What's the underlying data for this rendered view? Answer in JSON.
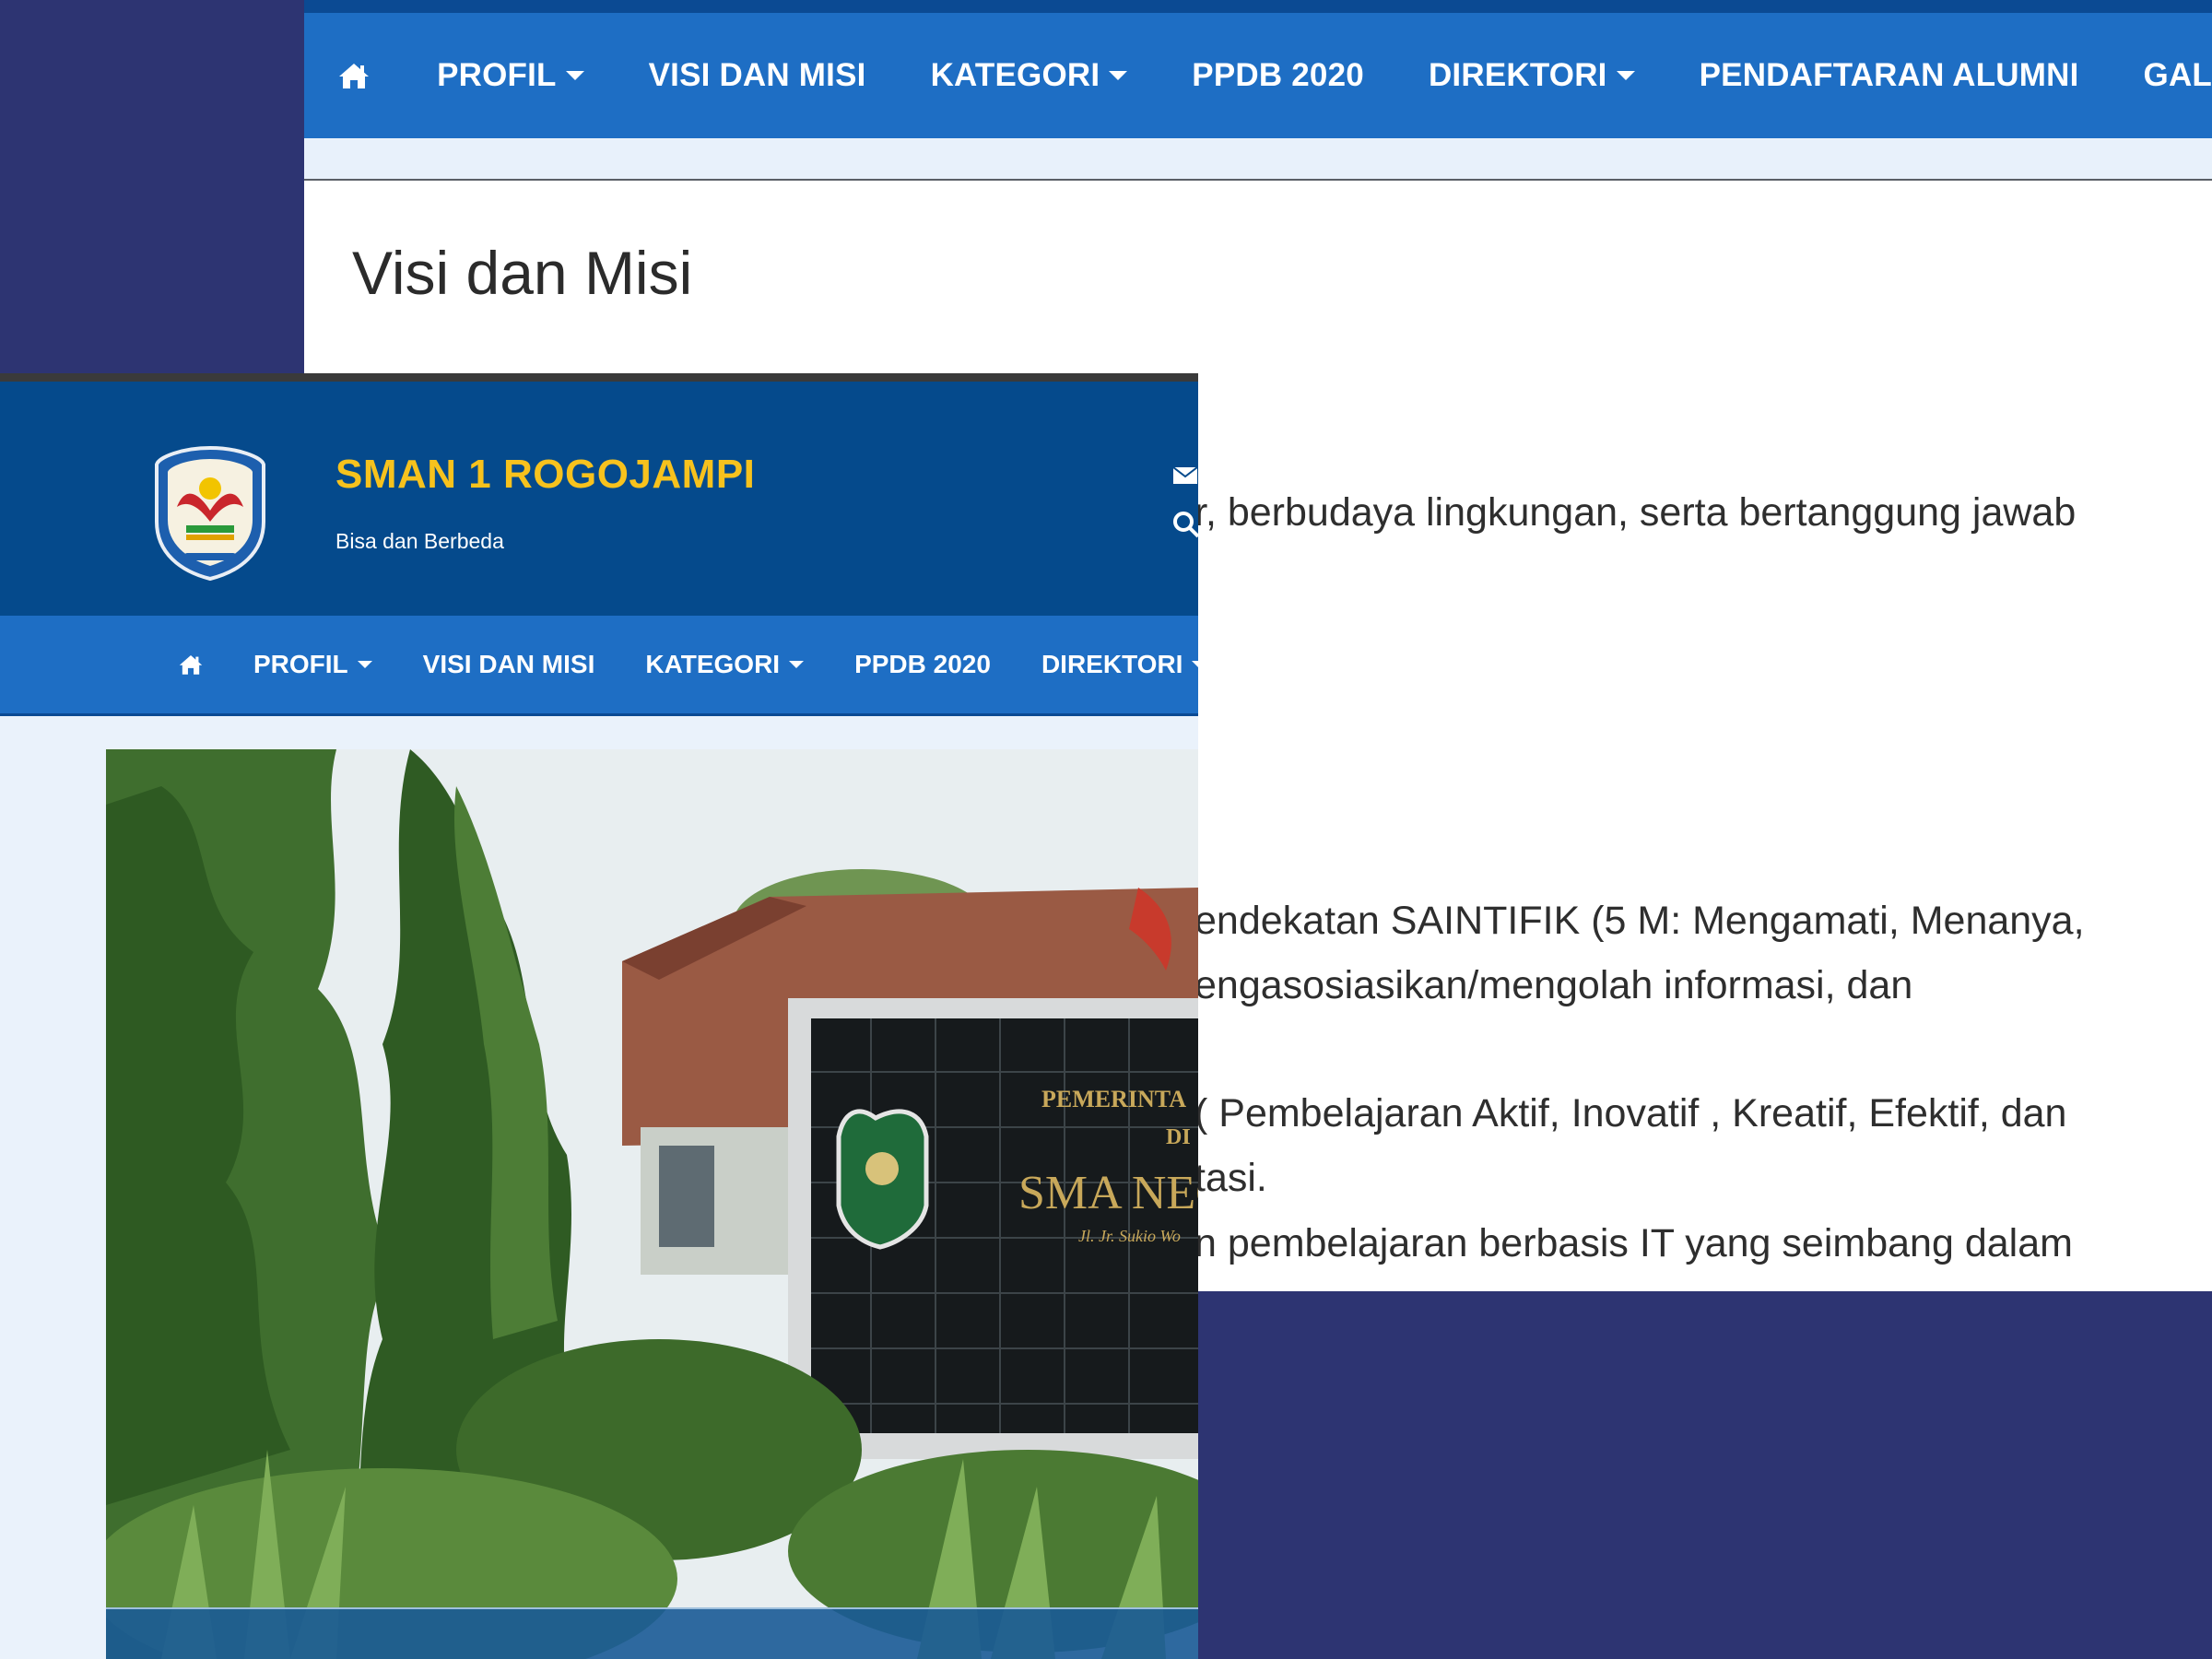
{
  "back_page": {
    "nav": {
      "home_icon": "home-icon",
      "items": [
        {
          "label": "PROFIL",
          "dropdown": true
        },
        {
          "label": "VISI DAN MISI",
          "dropdown": false
        },
        {
          "label": "KATEGORI",
          "dropdown": true
        },
        {
          "label": "PPDB 2020",
          "dropdown": false
        },
        {
          "label": "DIREKTORI",
          "dropdown": true
        },
        {
          "label": "PENDAFTARAN ALUMNI",
          "dropdown": false
        },
        {
          "label": "GAL",
          "dropdown": false
        }
      ]
    },
    "title": "Visi dan Misi",
    "content_lines": [
      "r, berbudaya lingkungan, serta bertanggung jawab",
      "endekatan SAINTIFIK (5 M: Mengamati, Menanya,",
      "engasosiasikan/mengolah informasi, dan",
      "(  Pembelajaran Aktif, Inovatif , Kreatif, Efektif, dan",
      "tasi.",
      "n pembelajaran berbasis IT yang seimbang dalam"
    ]
  },
  "front_page": {
    "header": {
      "site_title": "SMAN 1 ROGOJAMPI",
      "tagline": "Bisa dan Berbeda",
      "logo": "school-emblem-logo"
    },
    "nav": {
      "home_icon": "home-icon",
      "items": [
        {
          "label": "PROFIL",
          "dropdown": true
        },
        {
          "label": "VISI DAN MISI",
          "dropdown": false
        },
        {
          "label": "KATEGORI",
          "dropdown": true
        },
        {
          "label": "PPDB 2020",
          "dropdown": false
        },
        {
          "label": "DIREKTORI",
          "dropdown": true
        }
      ]
    },
    "hero": {
      "sign_line_1": "PEMERINTA",
      "sign_line_2": "DI",
      "sign_line_3": "SMA NEG",
      "sign_line_4": "Jl. Jr. Sukio Wo"
    }
  },
  "colors": {
    "desktop_bg": "#2d3472",
    "nav_blue": "#1e6ec4",
    "header_blue": "#054a8c",
    "title_yellow": "#f7c21d"
  }
}
